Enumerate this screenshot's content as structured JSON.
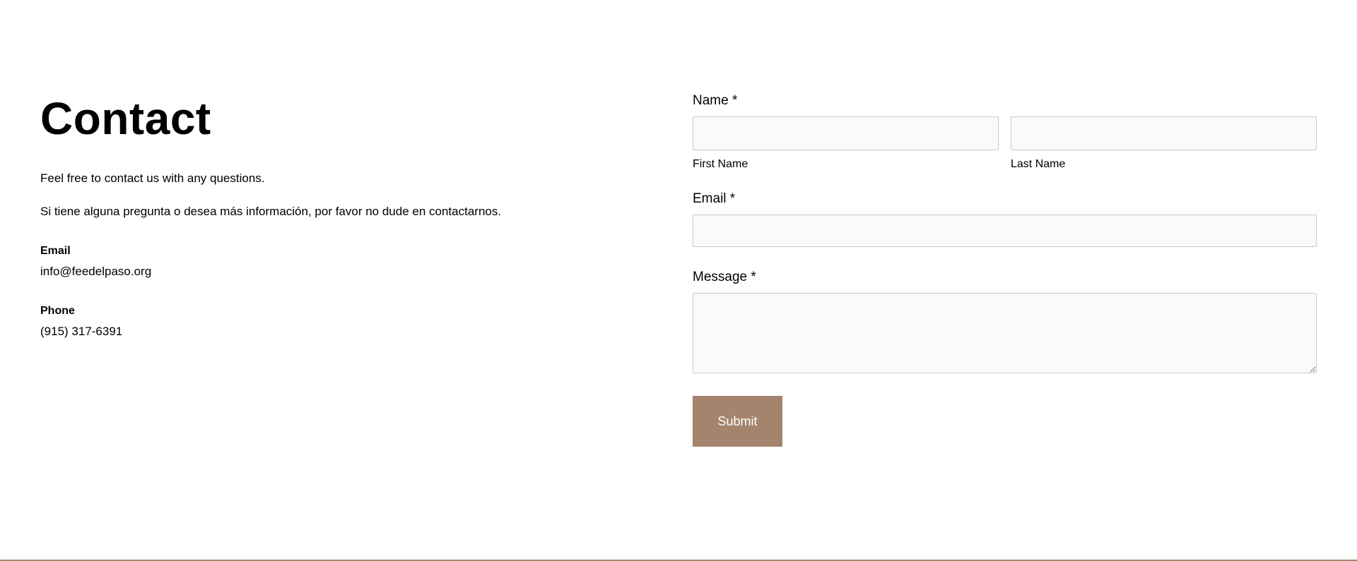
{
  "contact": {
    "title": "Contact",
    "intro_en": "Feel free to contact us with any questions.",
    "intro_es": "Si tiene alguna pregunta o desea más información, por favor no dude en contactarnos.",
    "email_label": "Email",
    "email_value": "info@feedelpaso.org",
    "phone_label": "Phone",
    "phone_value": "(915) 317-6391"
  },
  "form": {
    "name_label": "Name *",
    "first_name_label": "First Name",
    "last_name_label": "Last Name",
    "first_name_value": "",
    "last_name_value": "",
    "email_label": "Email *",
    "email_value": "",
    "message_label": "Message *",
    "message_value": "",
    "submit_label": "Submit"
  },
  "colors": {
    "accent": "#a4846d",
    "input_background": "#fafafa",
    "input_border": "#c9c9c9"
  }
}
